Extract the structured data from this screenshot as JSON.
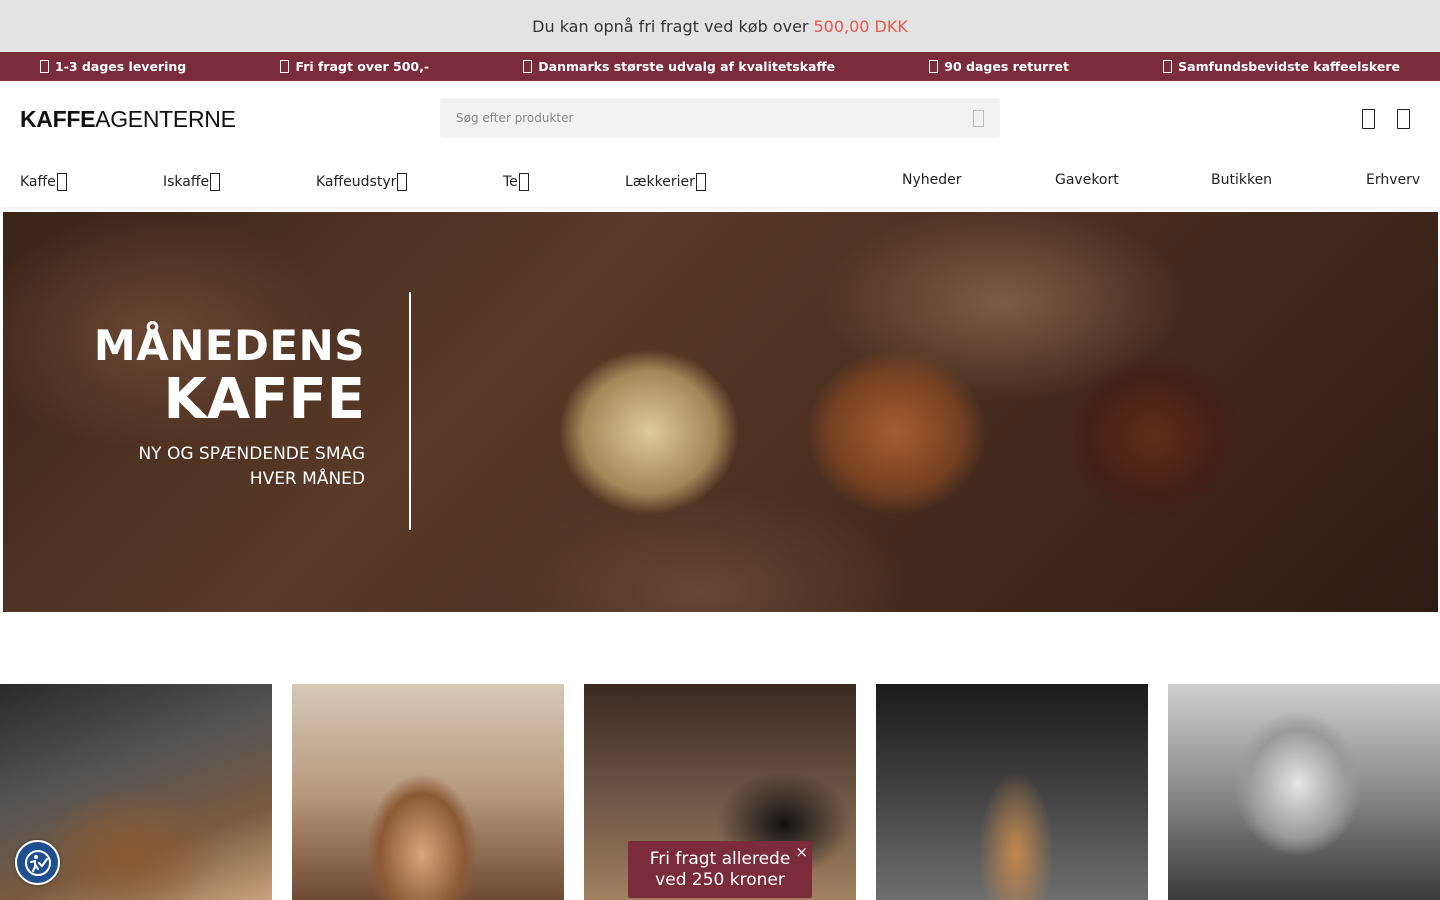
{
  "promo": {
    "text": "Du kan opnå fri fragt ved køb over",
    "amount": "500,00 DKK"
  },
  "usps": [
    {
      "label": "1-3 dages levering",
      "icon": "truck-icon"
    },
    {
      "label": "Fri fragt over 500,-",
      "icon": "tag-icon"
    },
    {
      "label": "Danmarks største udvalg af kvalitetskaffe",
      "icon": "coffee-icon"
    },
    {
      "label": "90 dages returret",
      "icon": "return-icon"
    },
    {
      "label": "Samfundsbevidste kaffeelskere",
      "icon": "heart-icon"
    }
  ],
  "header": {
    "logo_bold": "KAFFE",
    "logo_rest": "AGENTERNE",
    "search_placeholder": "Søg efter produkter",
    "icons": [
      "user-icon",
      "cart-icon"
    ]
  },
  "nav": {
    "dropdown_items": [
      "Kaffe",
      "Iskaffe",
      "Kaffeudstyr",
      "Te",
      "Lækkerier"
    ],
    "plain_items": [
      "Nyheder",
      "Gavekort",
      "Butikken",
      "Erhverv"
    ]
  },
  "hero": {
    "title_line1": "MÅNEDENS",
    "title_line2": "KAFFE",
    "subtitle_line1": "NY OG SPÆNDENDE SMAG",
    "subtitle_line2": "HVER MÅNED"
  },
  "popup": {
    "line1": "Fri fragt allerede",
    "line2": "ved 250 kroner",
    "close": "×"
  },
  "colors": {
    "accent": "#7b2c3b",
    "promo_amount": "#e8584f",
    "promo_bg": "#e3e3e3"
  }
}
